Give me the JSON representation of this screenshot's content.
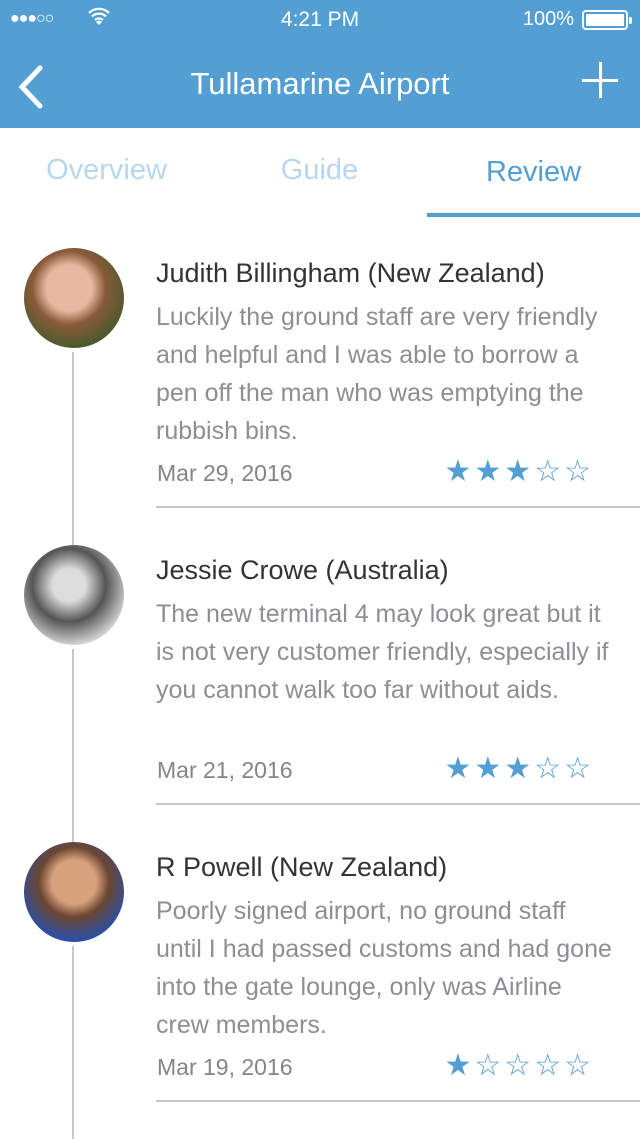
{
  "status": {
    "signal": "●●●○○",
    "wifi_icon": "wifi-icon",
    "time": "4:21 PM",
    "battery": "100%"
  },
  "nav": {
    "title": "Tullamarine Airport",
    "back_icon": "chevron-left-icon",
    "add_icon": "plus-icon"
  },
  "tabs": [
    {
      "label": "Overview"
    },
    {
      "label": "Guide"
    },
    {
      "label": "Review",
      "active": true
    }
  ],
  "accent": "#539fd3",
  "reviews": [
    {
      "name": "Judith Billingham (New Zealand)",
      "text": "Luckily the ground staff are very friendly and helpful and I was able to borrow a pen off the man who was emptying the rubbish bins.",
      "date": "Mar 29, 2016",
      "rating": 3
    },
    {
      "name": "Jessie Crowe (Australia)",
      "text": "The new terminal 4 may look great but it is not very customer friendly, especially if you cannot walk too far without aids.",
      "date": "Mar 21, 2016",
      "rating": 3
    },
    {
      "name": "R Powell (New Zealand)",
      "text": "Poorly signed airport, no ground staff until I had passed customs and had gone into the gate lounge, only was Airline crew members.",
      "date": "Mar 19, 2016",
      "rating": 1
    }
  ]
}
